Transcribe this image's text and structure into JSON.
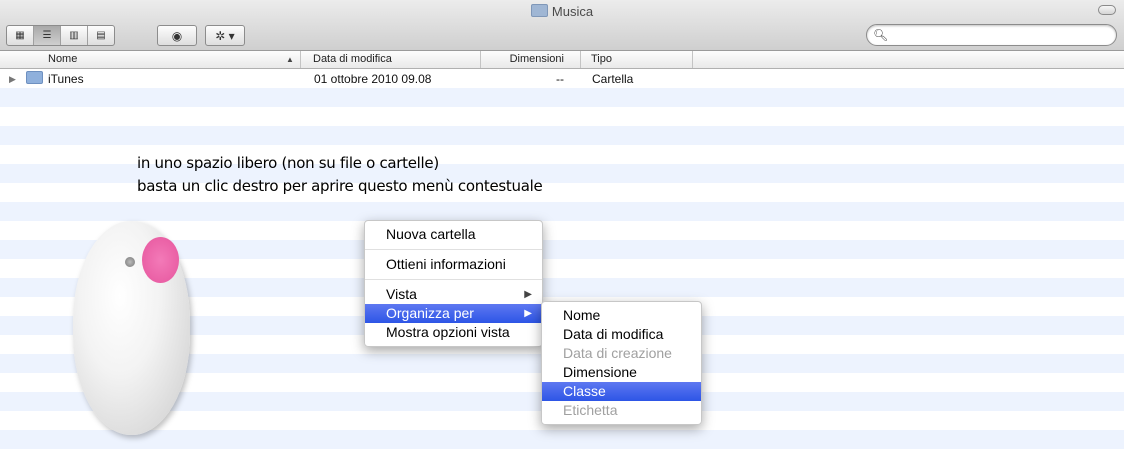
{
  "window": {
    "title": "Musica"
  },
  "toolbar": {
    "view_buttons": [
      {
        "name": "icon-view",
        "glyph": "▦"
      },
      {
        "name": "list-view",
        "glyph": "☰"
      },
      {
        "name": "column-view",
        "glyph": "▥"
      },
      {
        "name": "coverflow-view",
        "glyph": "▤"
      }
    ],
    "quicklook_glyph": "◉",
    "action_glyph": "✲ ▾",
    "search": {
      "value": "",
      "placeholder": ""
    }
  },
  "columns": {
    "name": "Nome",
    "modified": "Data di modifica",
    "size": "Dimensioni",
    "kind": "Tipo"
  },
  "files": [
    {
      "name": "iTunes",
      "modified": "01 ottobre 2010 09.08",
      "size": "--",
      "kind": "Cartella"
    }
  ],
  "annotation": {
    "line1": "in uno spazio libero (non su file o cartelle)",
    "line2": "basta un clic destro per aprire questo menù contestuale"
  },
  "context_menu": {
    "new_folder": "Nuova cartella",
    "get_info": "Ottieni informazioni",
    "view": "Vista",
    "arrange_by": "Organizza per",
    "show_view_options": "Mostra opzioni vista"
  },
  "submenu": {
    "name": "Nome",
    "date_modified": "Data di modifica",
    "date_created": "Data di creazione",
    "size": "Dimensione",
    "kind": "Classe",
    "label": "Etichetta"
  },
  "colors": {
    "selection": "#3d61ea",
    "stripe": "#edf3fe",
    "mouse_button": "#ec67ab"
  }
}
